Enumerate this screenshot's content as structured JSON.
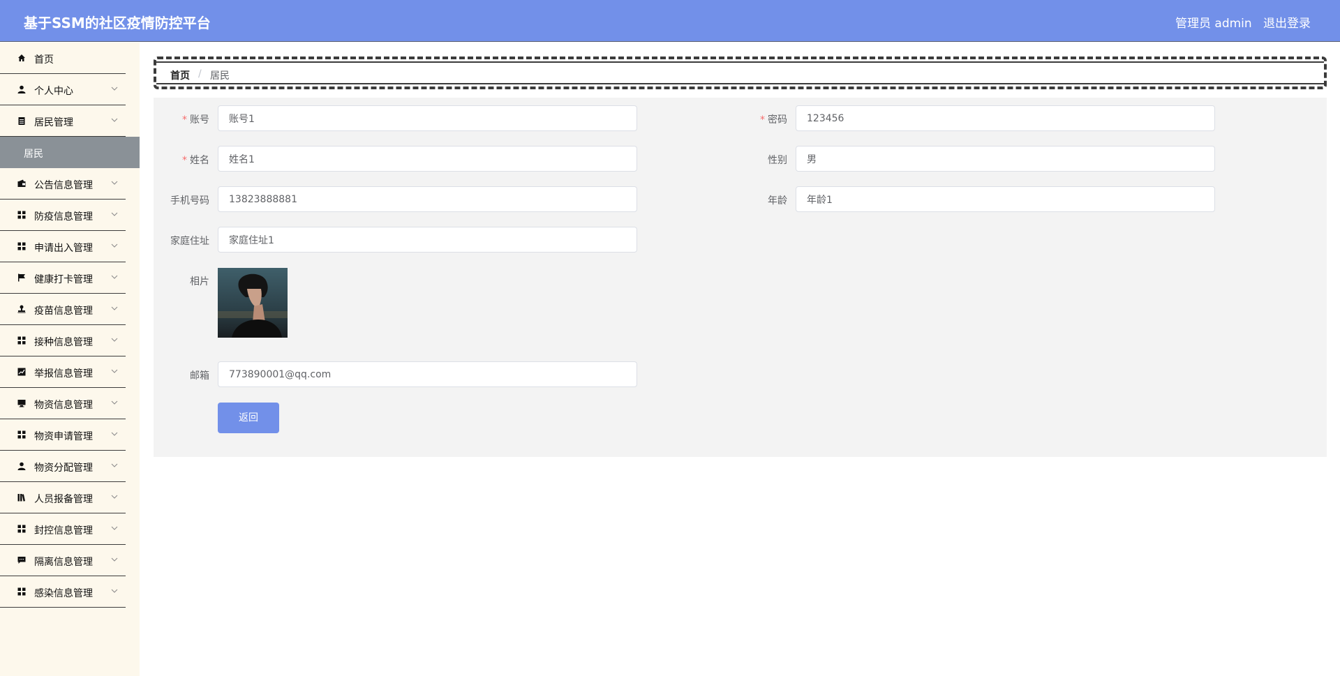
{
  "header": {
    "title": "基于SSM的社区疫情防控平台",
    "user": "管理员 admin",
    "logout": "退出登录"
  },
  "sidebar": {
    "items": [
      {
        "label": "首页",
        "icon": "home-icon",
        "chevron": false
      },
      {
        "label": "个人中心",
        "icon": "user-icon",
        "chevron": true
      },
      {
        "label": "居民管理",
        "icon": "clipboard-icon",
        "chevron": true
      },
      {
        "label": "公告信息管理",
        "icon": "wallet-icon",
        "chevron": true
      },
      {
        "label": "防疫信息管理",
        "icon": "grid-icon",
        "chevron": true
      },
      {
        "label": "申请出入管理",
        "icon": "grid-icon",
        "chevron": true
      },
      {
        "label": "健康打卡管理",
        "icon": "flag-icon",
        "chevron": true
      },
      {
        "label": "疫苗信息管理",
        "icon": "stamp-icon",
        "chevron": true
      },
      {
        "label": "接种信息管理",
        "icon": "grid-icon",
        "chevron": true
      },
      {
        "label": "举报信息管理",
        "icon": "chart-icon",
        "chevron": true
      },
      {
        "label": "物资信息管理",
        "icon": "monitor-icon",
        "chevron": true
      },
      {
        "label": "物资申请管理",
        "icon": "grid-icon",
        "chevron": true
      },
      {
        "label": "物资分配管理",
        "icon": "user-icon",
        "chevron": true
      },
      {
        "label": "人员报备管理",
        "icon": "books-icon",
        "chevron": true
      },
      {
        "label": "封控信息管理",
        "icon": "grid-icon",
        "chevron": true
      },
      {
        "label": "隔离信息管理",
        "icon": "chat-icon",
        "chevron": true
      },
      {
        "label": "感染信息管理",
        "icon": "grid-icon",
        "chevron": true
      }
    ],
    "active_sub": "居民"
  },
  "breadcrumb": {
    "home": "首页",
    "separator": "/",
    "current": "居民"
  },
  "form": {
    "account_label": "账号",
    "account_value": "账号1",
    "password_label": "密码",
    "password_value": "123456",
    "name_label": "姓名",
    "name_value": "姓名1",
    "gender_label": "性别",
    "gender_value": "男",
    "phone_label": "手机号码",
    "phone_value": "13823888881",
    "age_label": "年龄",
    "age_value": "年龄1",
    "address_label": "家庭住址",
    "address_value": "家庭住址1",
    "photo_label": "相片",
    "email_label": "邮箱",
    "email_value": "773890001@qq.com",
    "back_button": "返回"
  },
  "colors": {
    "header_bg": "#7290e9",
    "sidebar_bg": "#fdf8ec",
    "active_sub_bg": "#8a9197",
    "panel_bg": "#f3f3f3",
    "required": "#f56c6c",
    "button_bg": "#7290e9"
  }
}
